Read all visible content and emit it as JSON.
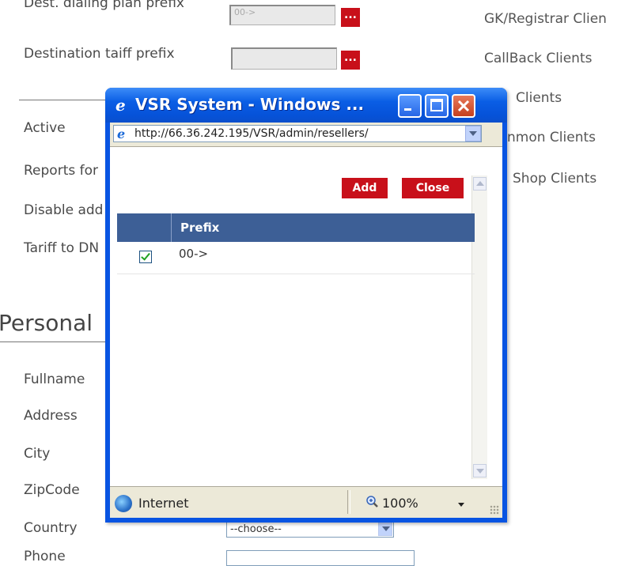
{
  "background_form": {
    "dest_dialing_prefix": {
      "label": "Dest. dialing plan prefix",
      "value": "00->"
    },
    "dest_tariff_prefix": {
      "label": "Destination taiff prefix",
      "value": ""
    },
    "dots_label": "...",
    "rows": [
      {
        "label": "Active"
      },
      {
        "label": "Reports for"
      },
      {
        "label": "Disable add"
      },
      {
        "label": "Tariff to DN"
      }
    ],
    "personal_section": "Personal",
    "personal_fields": [
      {
        "label": "Fullname"
      },
      {
        "label": "Address"
      },
      {
        "label": "City"
      },
      {
        "label": "ZipCode"
      },
      {
        "label": "Country"
      },
      {
        "label": "Phone"
      }
    ],
    "country_select": "--choose--"
  },
  "right_links": [
    "GK/Registrar Clien",
    "CallBack Clients",
    "Clients",
    "nmon Clients",
    "Shop Clients"
  ],
  "popup": {
    "title": "VSR System - Windows ...",
    "address": "http://66.36.242.195/VSR/admin/resellers/",
    "buttons": {
      "add": "Add",
      "close": "Close"
    },
    "table": {
      "header": "Prefix",
      "rows": [
        {
          "checked": true,
          "prefix": "00->"
        }
      ]
    },
    "status": {
      "zone": "Internet",
      "zoom": "100%"
    }
  },
  "colors": {
    "accent_red": "#c8101a",
    "table_header": "#3d5f96",
    "xp_blue": "#0854e2"
  }
}
